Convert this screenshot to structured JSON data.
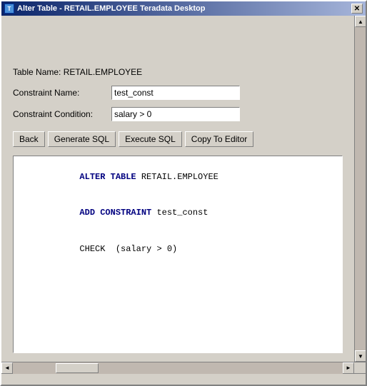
{
  "window": {
    "title": "Alter Table - RETAIL.EMPLOYEE Teradata Desktop",
    "icon": "table-icon"
  },
  "form": {
    "table_name_label": "Table Name: RETAIL.EMPLOYEE",
    "constraint_name_label": "Constraint Name:",
    "constraint_name_value": "test_const",
    "constraint_condition_label": "Constraint Condition:",
    "constraint_condition_value": "salary > 0"
  },
  "buttons": {
    "back": "Back",
    "generate_sql": "Generate SQL",
    "execute_sql": "Execute SQL",
    "copy_to_editor": "Copy To Editor"
  },
  "sql_output": {
    "lines": [
      {
        "type": "mixed",
        "parts": [
          {
            "text": "ALTER TABLE ",
            "style": "keyword"
          },
          {
            "text": "RETAIL.EMPLOYEE",
            "style": "normal"
          }
        ]
      },
      {
        "type": "mixed",
        "parts": [
          {
            "text": "ADD CONSTRAINT ",
            "style": "keyword"
          },
          {
            "text": "test_const",
            "style": "normal"
          }
        ]
      },
      {
        "type": "mixed",
        "parts": [
          {
            "text": "CHECK  (salary > 0)",
            "style": "normal"
          }
        ]
      }
    ]
  },
  "scrollbar": {
    "up_arrow": "▲",
    "down_arrow": "▼",
    "left_arrow": "◄",
    "right_arrow": "►"
  }
}
